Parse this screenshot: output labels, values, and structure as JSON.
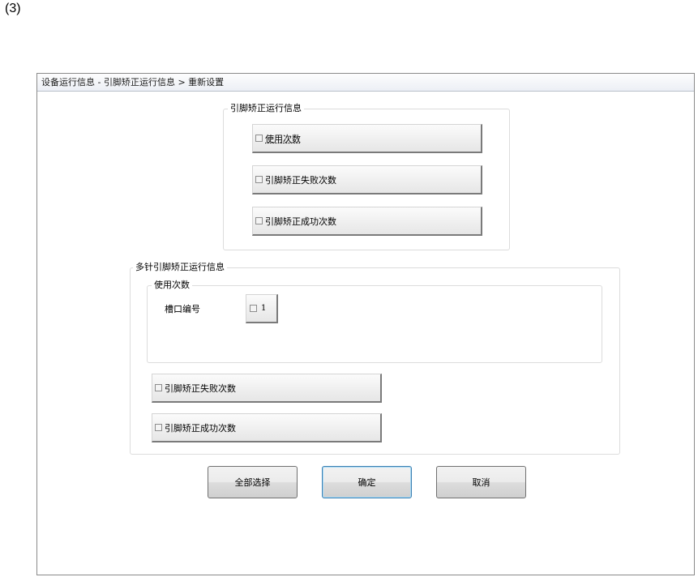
{
  "page_label": "(3)",
  "window": {
    "title": "设备运行信息 - 引脚矫正运行信息 > 重新设置"
  },
  "single_group": {
    "title": "引脚矫正运行信息",
    "options": [
      {
        "label": "使用次数"
      },
      {
        "label": "引脚矫正失败次数"
      },
      {
        "label": "引脚矫正成功次数"
      }
    ]
  },
  "multi_group": {
    "title": "多针引脚矫正运行信息",
    "usage": {
      "title": "使用次数",
      "slot_label": "槽口编号",
      "slot_value": "1"
    },
    "options": [
      {
        "label": "引脚矫正失败次数"
      },
      {
        "label": "引脚矫正成功次数"
      }
    ]
  },
  "buttons": {
    "select_all": "全部选择",
    "ok": "确定",
    "cancel": "取消"
  }
}
